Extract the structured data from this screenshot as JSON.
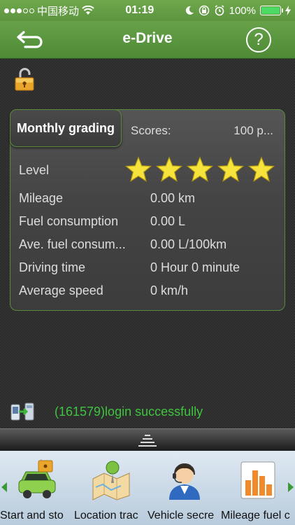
{
  "status_bar": {
    "carrier": "中国移动",
    "time": "01:19",
    "battery": "100%"
  },
  "nav": {
    "title": "e-Drive",
    "help_symbol": "?"
  },
  "card": {
    "tab_label": "Monthly grading",
    "scores_label": "Scores:",
    "scores_value": "100 p...",
    "level_label": "Level",
    "stars_filled": 5,
    "stars_total": 5,
    "rows": [
      {
        "label": "Mileage",
        "value": "0.00 km"
      },
      {
        "label": "Fuel consumption",
        "value": "0.00 L"
      },
      {
        "label": "Ave. fuel consum...",
        "value": "0.00 L/100km"
      },
      {
        "label": "Driving time",
        "value": "0 Hour 0 minute"
      },
      {
        "label": "Average speed",
        "value": "0 km/h"
      }
    ]
  },
  "status_message": "(161579)login successfully",
  "toolbar": {
    "items": [
      {
        "label": "Start and sto",
        "icon": "car-lock-icon"
      },
      {
        "label": "Location trac",
        "icon": "map-pin-icon"
      },
      {
        "label": "Vehicle secre",
        "icon": "secretary-icon"
      },
      {
        "label": "Mileage fuel c",
        "icon": "bar-chart-icon"
      }
    ]
  },
  "colors": {
    "header_green": "#5c9440",
    "status_green": "#3fc43f",
    "star_yellow": "#f5e23a"
  }
}
